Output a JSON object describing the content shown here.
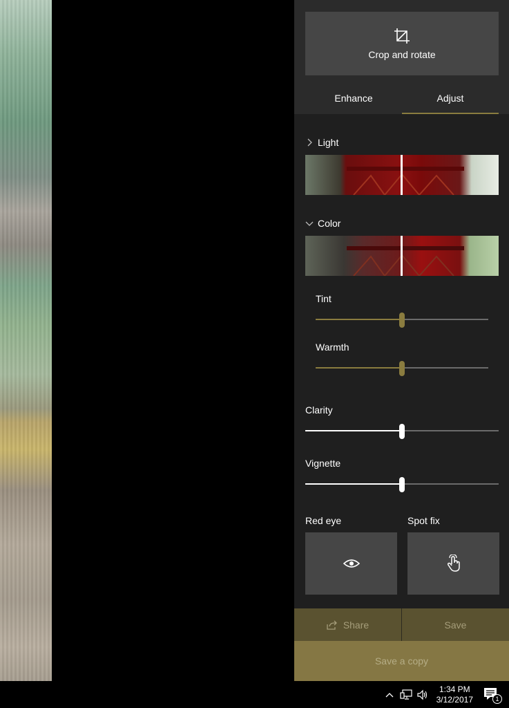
{
  "crop": {
    "label": "Crop and rotate",
    "icon": "crop-icon"
  },
  "tabs": [
    {
      "label": "Enhance",
      "active": false
    },
    {
      "label": "Adjust",
      "active": true
    }
  ],
  "sections": {
    "light": {
      "label": "Light",
      "expanded": false
    },
    "color": {
      "label": "Color",
      "expanded": true,
      "sliders": {
        "tint": {
          "label": "Tint",
          "value": 0.5
        },
        "warmth": {
          "label": "Warmth",
          "value": 0.5
        }
      }
    }
  },
  "clarity": {
    "label": "Clarity",
    "value": 0.5
  },
  "vignette": {
    "label": "Vignette",
    "value": 0.5
  },
  "tools": {
    "red_eye": {
      "label": "Red eye",
      "icon": "eye-icon"
    },
    "spot_fix": {
      "label": "Spot fix",
      "icon": "touch-icon"
    }
  },
  "actions": {
    "share": "Share",
    "save": "Save",
    "save_copy": "Save a copy"
  },
  "taskbar": {
    "time": "1:34 PM",
    "date": "3/12/2017",
    "notifications": "1"
  },
  "colors": {
    "accent": "#8a7c3f",
    "panel": "#1f1f1f",
    "button": "#464646",
    "action_bar": "#5a5230",
    "save_copy_bg": "#857744"
  }
}
